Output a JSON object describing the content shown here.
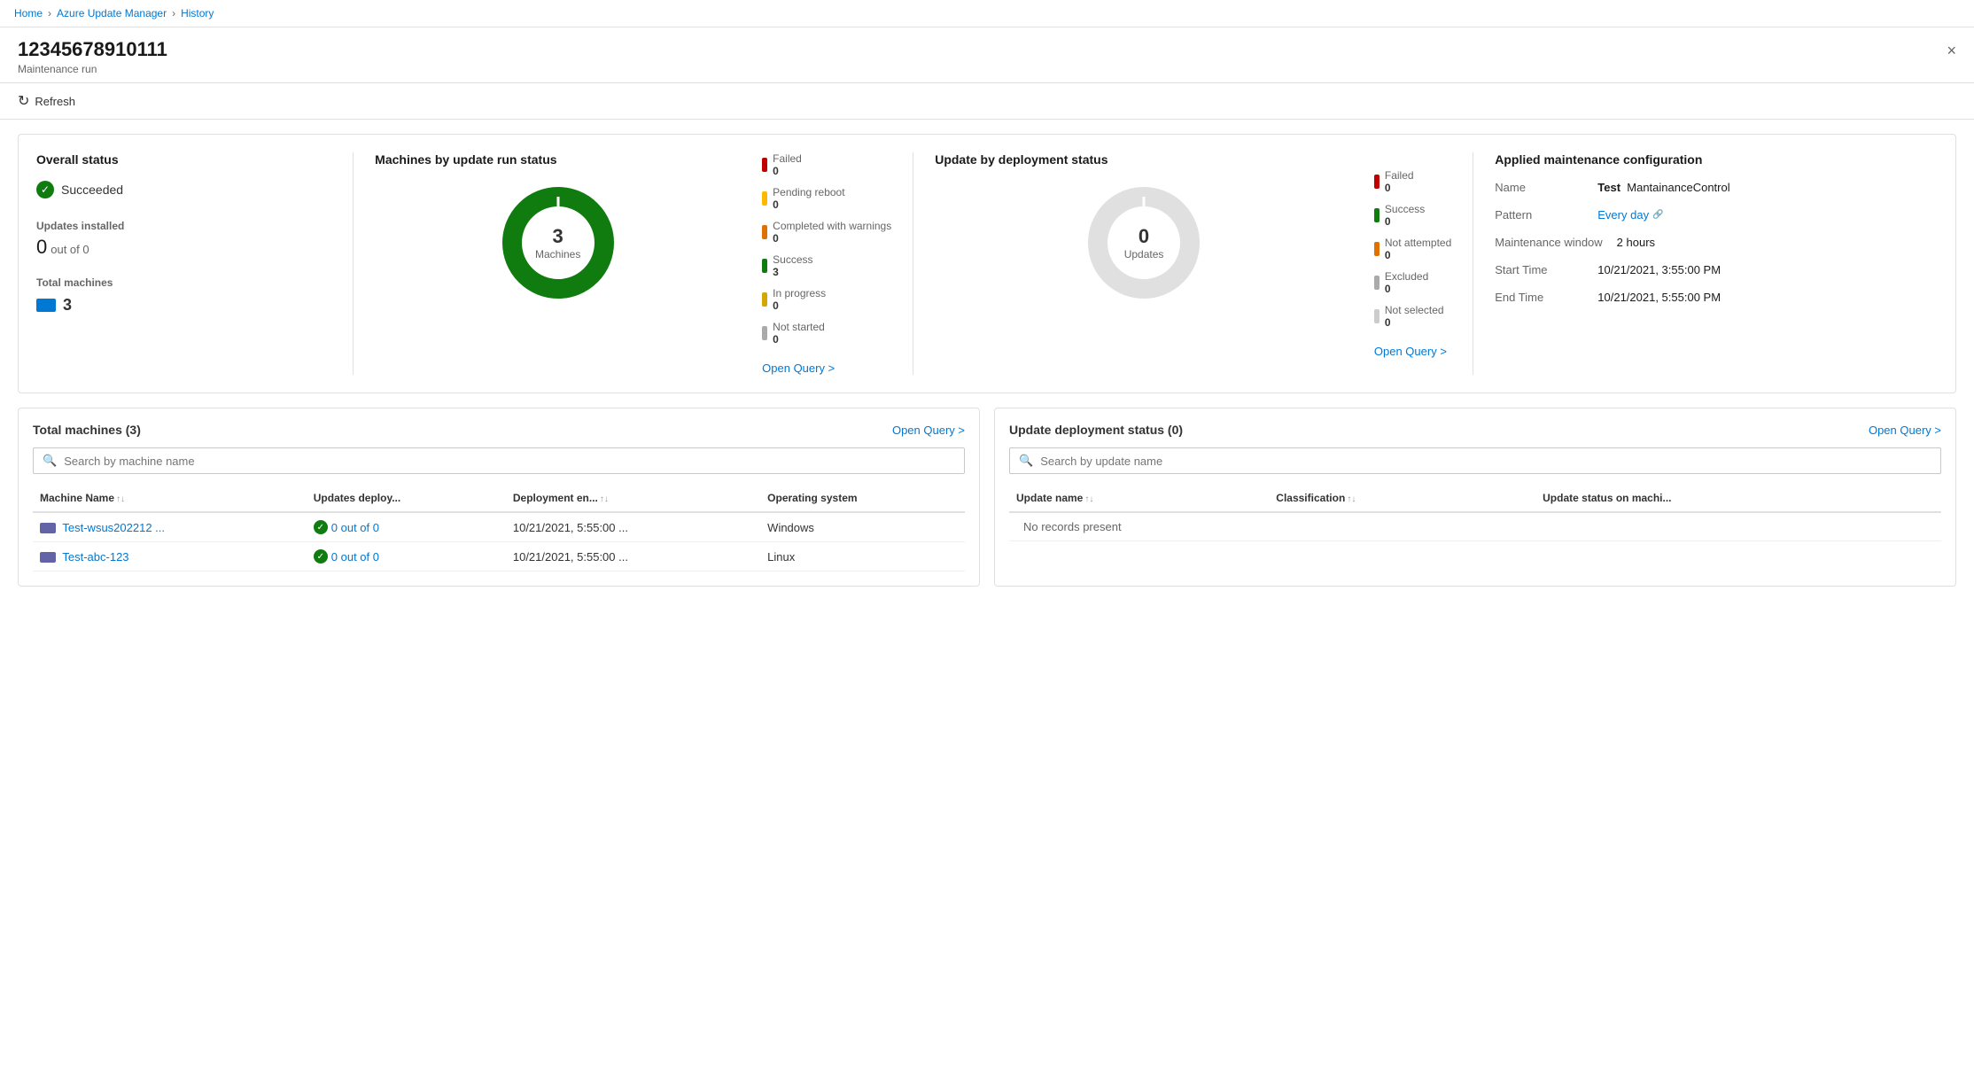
{
  "breadcrumb": {
    "items": [
      "Home",
      "Azure Update Manager",
      "History"
    ]
  },
  "header": {
    "title": "12345678910111",
    "subtitle": "Maintenance run",
    "close_label": "×"
  },
  "toolbar": {
    "refresh_label": "Refresh"
  },
  "page_title": "Azure Update Manager History",
  "overall_status": {
    "section_title": "Overall status",
    "status": "Succeeded",
    "updates_installed_label": "Updates installed",
    "updates_installed_value": "0",
    "updates_installed_suffix": "out of 0",
    "total_machines_label": "Total machines",
    "total_machines_value": "3"
  },
  "machines_chart": {
    "section_title": "Machines by update run status",
    "center_number": "3",
    "center_label": "Machines",
    "legend": [
      {
        "label": "Failed",
        "value": "0",
        "color": "#c00000"
      },
      {
        "label": "Pending reboot",
        "value": "0",
        "color": "#ffb900"
      },
      {
        "label": "Completed with warnings",
        "value": "0",
        "color": "#e07000"
      },
      {
        "label": "Success",
        "value": "3",
        "color": "#107c10"
      },
      {
        "label": "In progress",
        "value": "0",
        "color": "#d4a700"
      },
      {
        "label": "Not started",
        "value": "0",
        "color": "#aaa"
      }
    ],
    "open_query_label": "Open Query >"
  },
  "deployment_chart": {
    "section_title": "Update by deployment status",
    "center_number": "0",
    "center_label": "Updates",
    "legend": [
      {
        "label": "Failed",
        "value": "0",
        "color": "#c00000"
      },
      {
        "label": "Success",
        "value": "0",
        "color": "#107c10"
      },
      {
        "label": "Not attempted",
        "value": "0",
        "color": "#e07000"
      },
      {
        "label": "Excluded",
        "value": "0",
        "color": "#aaa"
      },
      {
        "label": "Not selected",
        "value": "0",
        "color": "#ccc"
      }
    ],
    "open_query_label": "Open Query >"
  },
  "maintenance_config": {
    "section_title": "Applied maintenance configuration",
    "fields": [
      {
        "key": "Name",
        "value": "MantainanceControl",
        "value_prefix": "Test",
        "value_prefix_bold": true
      },
      {
        "key": "Pattern",
        "value": "Every day",
        "is_link": true
      },
      {
        "key": "Maintenance window",
        "value": "2 hours"
      },
      {
        "key": "Start Time",
        "value": "10/21/2021, 3:55:00 PM"
      },
      {
        "key": "End Time",
        "value": "10/21/2021, 5:55:00 PM"
      }
    ]
  },
  "machines_table": {
    "title": "Total machines (3)",
    "open_query_label": "Open Query >",
    "search_placeholder": "Search by machine name",
    "columns": [
      "Machine Name",
      "Updates deploy...",
      "Deployment en...",
      "Operating system"
    ],
    "rows": [
      {
        "name": "Test-wsus202212 ...",
        "updates": "0 out of 0",
        "deployment_end": "10/21/2021, 5:55:00 ...",
        "os": "Windows"
      },
      {
        "name": "Test-abc-123",
        "updates": "0 out of 0",
        "deployment_end": "10/21/2021, 5:55:00 ...",
        "os": "Linux"
      }
    ]
  },
  "updates_table": {
    "title": "Update deployment status (0)",
    "open_query_label": "Open Query >",
    "search_placeholder": "Search by update name",
    "columns": [
      "Update name",
      "Classification",
      "Update status on machi..."
    ],
    "no_records": "No records present"
  },
  "colors": {
    "green": "#107c10",
    "red": "#c00000",
    "orange": "#e07000",
    "yellow": "#ffb900",
    "blue": "#0078d4",
    "gray": "#aaa"
  }
}
